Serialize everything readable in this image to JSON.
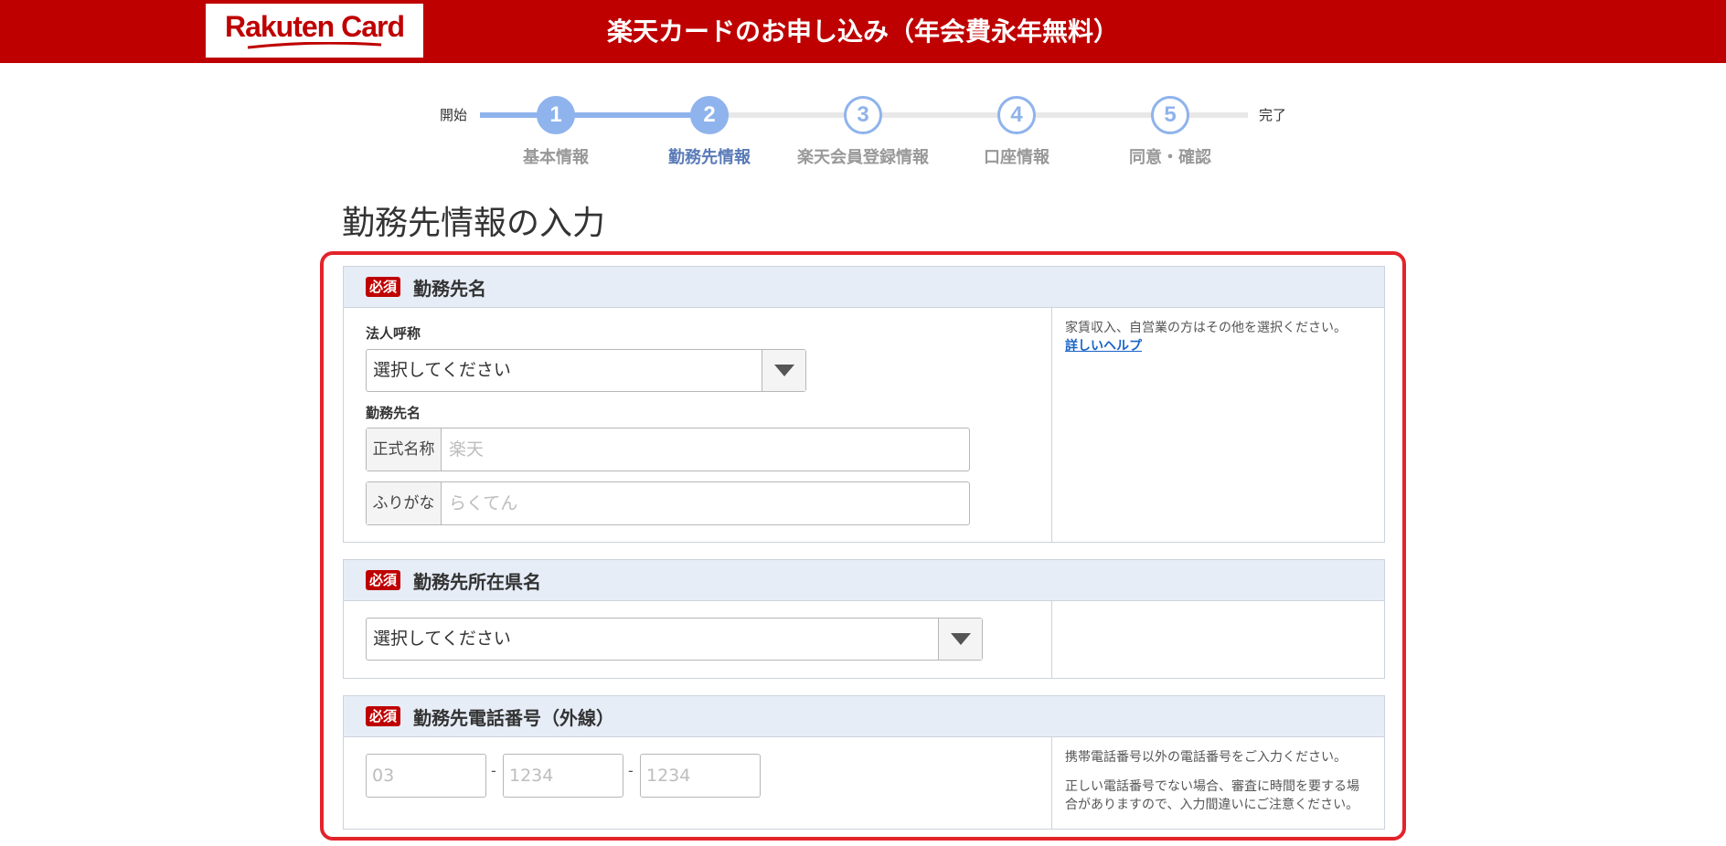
{
  "header": {
    "logo_text": "Rakuten Card",
    "title": "楽天カードのお申し込み（年会費永年無料）",
    "brand_color": "#bf0000"
  },
  "stepper": {
    "start_label": "開始",
    "end_label": "完了",
    "current_step": 2,
    "steps": [
      {
        "number": "1",
        "label": "基本情報"
      },
      {
        "number": "2",
        "label": "勤務先情報"
      },
      {
        "number": "3",
        "label": "楽天会員登録情報"
      },
      {
        "number": "4",
        "label": "口座情報"
      },
      {
        "number": "5",
        "label": "同意・確認"
      }
    ]
  },
  "page_title": "勤務先情報の入力",
  "sections": {
    "employer": {
      "required_badge": "必須",
      "title": "勤務先名",
      "corp_type_label": "法人呼称",
      "corp_type_value": "選択してください",
      "name_label": "勤務先名",
      "official_addon": "正式名称",
      "official_placeholder": "楽天",
      "kana_addon": "ふりがな",
      "kana_placeholder": "らくてん",
      "help_text": "家賃収入、自営業の方はその他を選択ください。",
      "help_link": "詳しいヘルプ"
    },
    "prefecture": {
      "required_badge": "必須",
      "title": "勤務先所在県名",
      "select_value": "選択してください"
    },
    "phone": {
      "required_badge": "必須",
      "title": "勤務先電話番号（外線）",
      "part1_placeholder": "03",
      "part2_placeholder": "1234",
      "part3_placeholder": "1234",
      "separator": "-",
      "note1": "携帯電話番号以外の電話番号をご入力ください。",
      "note2": "正しい電話番号でない場合、審査に時間を要する場合がありますので、入力間違いにご注意ください。"
    }
  }
}
